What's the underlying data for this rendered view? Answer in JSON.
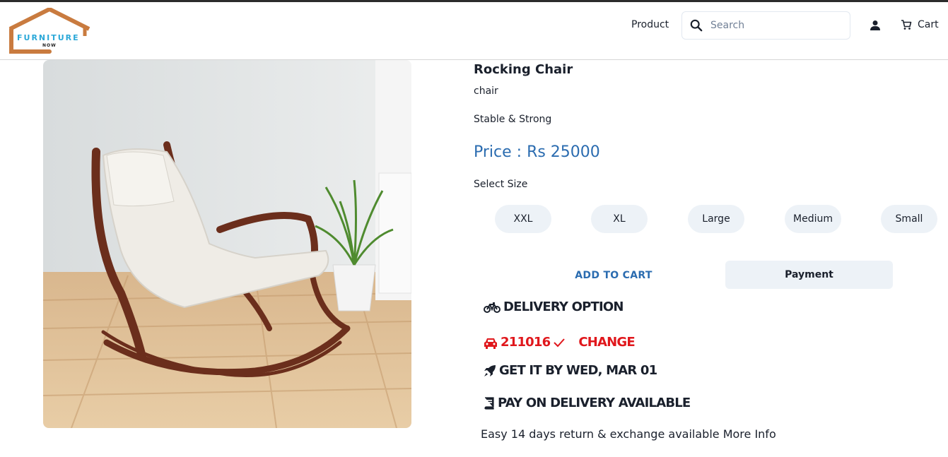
{
  "logo": {
    "text": "FURNITURE",
    "sub": "NOW",
    "roof_color": "#c97b3f",
    "text_color": "#2aa8d8"
  },
  "nav": {
    "product_label": "Product",
    "search_placeholder": "Search",
    "cart_label": "Cart"
  },
  "product": {
    "title": "Rocking Chair",
    "category": "chair",
    "description": "Stable & Strong",
    "price": "Price : Rs 25000",
    "select_size_label": "Select Size",
    "sizes": [
      "XXL",
      "XL",
      "Large",
      "Medium",
      "Small"
    ],
    "add_to_cart_label": "ADD TO CART",
    "payment_label": "Payment"
  },
  "delivery": {
    "option_label": "DELIVERY OPTION",
    "pincode": "211016",
    "change_label": "CHANGE",
    "eta": "GET IT BY WED, MAR 01",
    "pay_on_delivery": "PAY ON DELIVERY AVAILABLE",
    "returns_text": "Easy 14 days return & exchange available More Info"
  },
  "colors": {
    "accent_blue": "#2b6cb0",
    "alert_red": "#e0171c",
    "button_bg": "#edf2f7"
  },
  "icons": [
    "search-icon",
    "user-icon",
    "cart-icon",
    "bicycle-icon",
    "car-icon",
    "check-icon",
    "rocket-icon",
    "book-icon"
  ]
}
